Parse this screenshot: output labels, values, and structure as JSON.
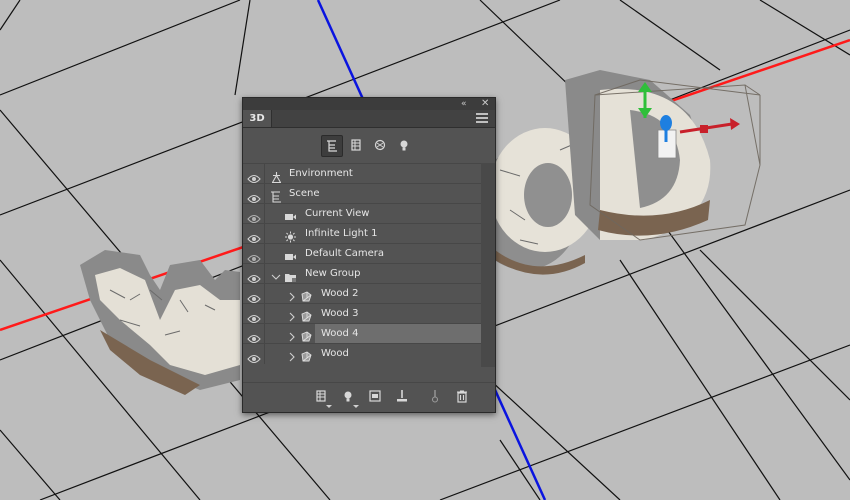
{
  "panel": {
    "tab_label": "3D",
    "collapse_glyph": "«",
    "close_glyph": "✕",
    "filter_buttons": [
      {
        "icon": "scene-filter-icon",
        "active": true
      },
      {
        "icon": "mesh-filter-icon",
        "active": false
      },
      {
        "icon": "material-filter-icon",
        "active": false
      },
      {
        "icon": "light-filter-icon",
        "active": false
      }
    ],
    "layers": [
      {
        "label": "Environment",
        "icon": "environment-icon",
        "indent": 0,
        "visible": true
      },
      {
        "label": "Scene",
        "icon": "scene-icon",
        "indent": 0,
        "visible": true
      },
      {
        "label": "Current View",
        "icon": "camera-icon",
        "indent": 1,
        "visible": false
      },
      {
        "label": "Infinite Light 1",
        "icon": "light-icon",
        "indent": 1,
        "visible": true
      },
      {
        "label": "Default Camera",
        "icon": "camera-icon",
        "indent": 1,
        "visible": false
      },
      {
        "label": "New Group",
        "icon": "group-folder-icon",
        "indent": 1,
        "visible": true,
        "expanded": true
      },
      {
        "label": "Wood 2",
        "icon": "mesh-icon",
        "indent": 2,
        "visible": true
      },
      {
        "label": "Wood 3",
        "icon": "mesh-icon",
        "indent": 2,
        "visible": true
      },
      {
        "label": "Wood 4",
        "icon": "mesh-icon",
        "indent": 2,
        "visible": true,
        "selected": true
      },
      {
        "label": "Wood",
        "icon": "mesh-icon",
        "indent": 2,
        "visible": true
      }
    ],
    "bottom_buttons": [
      {
        "icon": "new-mesh-icon",
        "has_menu": true
      },
      {
        "icon": "new-light-icon",
        "has_menu": true
      },
      {
        "icon": "add-constraint-icon",
        "has_menu": false
      },
      {
        "icon": "drop-to-ground-icon",
        "has_menu": false
      },
      {
        "icon": "instance-icon",
        "has_menu": false
      },
      {
        "icon": "delete-icon",
        "has_menu": false
      }
    ]
  },
  "colors": {
    "axis_x": "#ff1a1a",
    "axis_y": "#0a14e0",
    "gizmo_green": "#2fbf3a",
    "gizmo_blue": "#1e7fe0",
    "gizmo_red": "#c8202a"
  }
}
